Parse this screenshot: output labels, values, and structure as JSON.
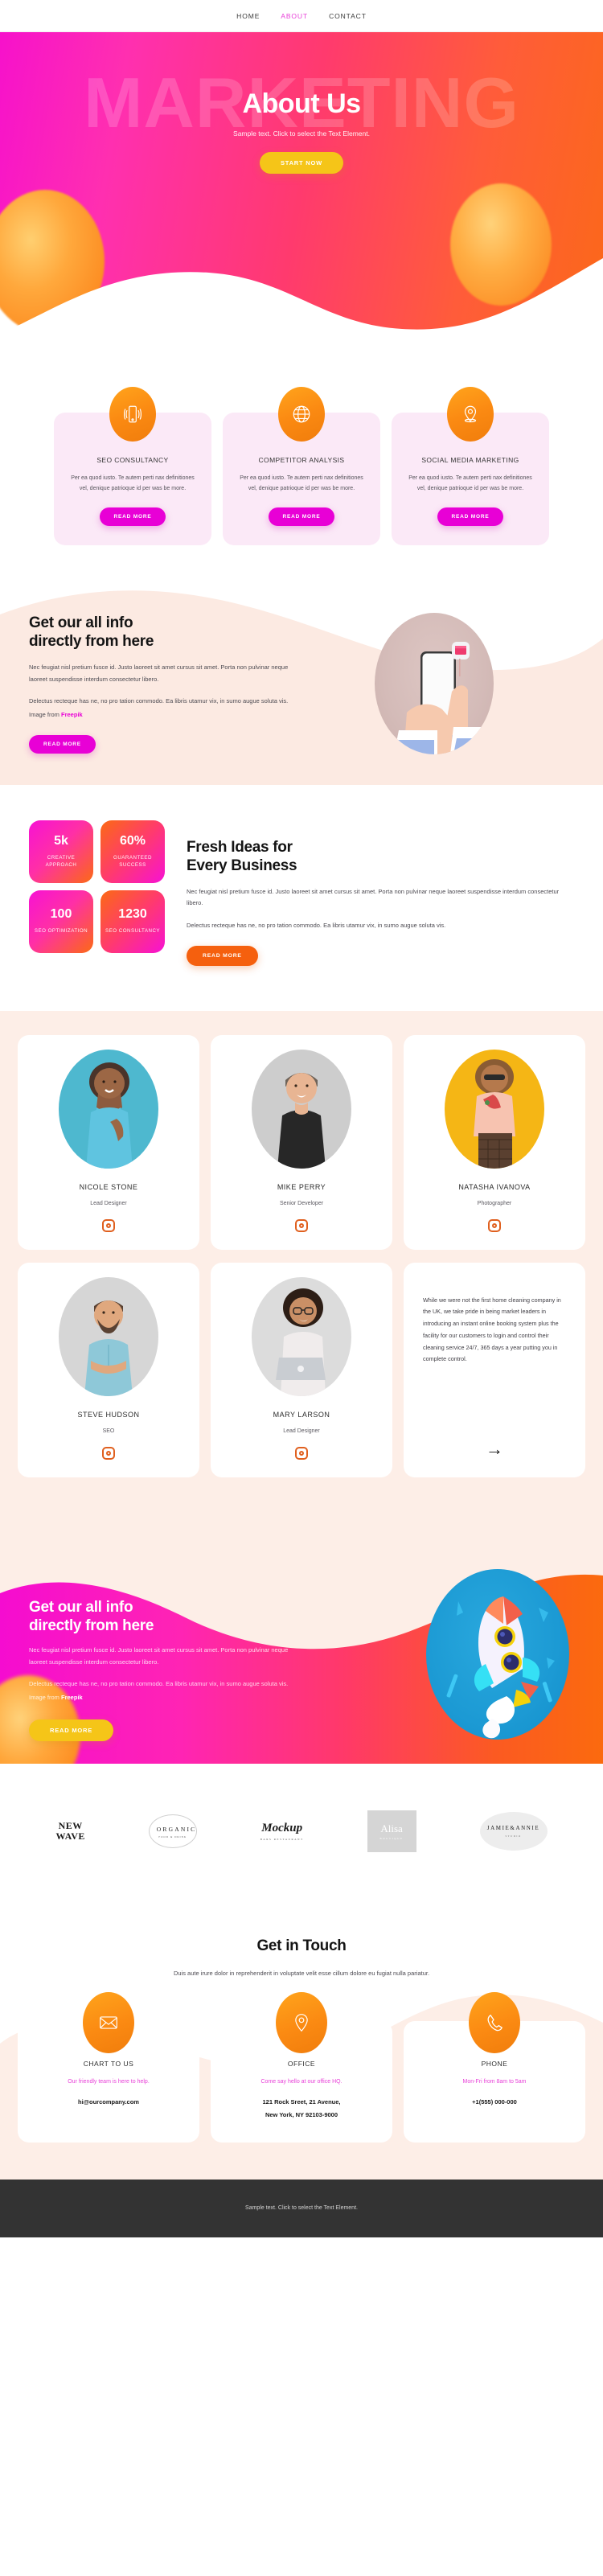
{
  "nav": {
    "items": [
      {
        "label": "HOME",
        "active": false
      },
      {
        "label": "ABOUT",
        "active": true
      },
      {
        "label": "CONTACT",
        "active": false
      }
    ]
  },
  "hero": {
    "ghost_word": "MARKETING",
    "title": "About Us",
    "subtitle": "Sample text. Click to select the Text Element.",
    "cta_label": "START NOW"
  },
  "services": {
    "items": [
      {
        "icon": "mobile-signal-icon",
        "title": "SEO CONSULTANCY",
        "text": "Per ea quod iusto. Te autem perti nax definitiones vel, denique patrioque id per was be more.",
        "button": "READ MORE"
      },
      {
        "icon": "globe-icon",
        "title": "COMPETITOR ANALYSIS",
        "text": "Per ea quod iusto. Te autem perti nax definitiones vel, denique patrioque id per was be more.",
        "button": "READ MORE"
      },
      {
        "icon": "map-pin-icon",
        "title": "SOCIAL MEDIA MARKETING",
        "text": "Per ea quod iusto. Te autem perti nax definitiones vel, denique patrioque id per was be more.",
        "button": "READ MORE"
      }
    ]
  },
  "info": {
    "title_line1": "Get our all info",
    "title_line2": "directly from here",
    "paragraph1": "Nec feugiat nisl pretium fusce id. Justo laoreet sit amet cursus sit amet. Porta non pulvinar neque laoreet suspendisse interdum consectetur libero.",
    "paragraph2_pre": "Delectus recteque has ne, no pro tation commodo. Ea libris utamur vix, in sumo augue soluta vis. Image from ",
    "paragraph2_link": "Freepik",
    "button": "READ MORE",
    "image_alt": "hand-holding-phone-illustration"
  },
  "stats": {
    "boxes": [
      {
        "number": "5k",
        "label": "CREATIVE APPROACH"
      },
      {
        "number": "60%",
        "label": "GUARANTEED SUCCESS"
      },
      {
        "number": "100",
        "label": "SEO OPTIMIZATION"
      },
      {
        "number": "1230",
        "label": "SEO CONSULTANCY"
      }
    ],
    "title_line1": "Fresh Ideas for",
    "title_line2": "Every Business",
    "paragraph1": "Nec feugiat nisl pretium fusce id. Justo laoreet sit amet cursus sit amet. Porta non pulvinar neque laoreet suspendisse interdum consectetur libero.",
    "paragraph2": "Delectus recteque has ne, no pro tation commodo. Ea libris utamur vix, in sumo augue soluta vis.",
    "button": "READ MORE"
  },
  "team": {
    "members": [
      {
        "name": "NICOLE STONE",
        "role": "Lead Designer",
        "social": "instagram-icon"
      },
      {
        "name": "MIKE PERRY",
        "role": "Senior Developer",
        "social": "instagram-icon"
      },
      {
        "name": "NATASHA IVANOVA",
        "role": "Photographer",
        "social": "instagram-icon"
      },
      {
        "name": "STEVE HUDSON",
        "role": "SEO",
        "social": "instagram-icon"
      },
      {
        "name": "MARY LARSON",
        "role": "Lead Designer",
        "social": "instagram-icon"
      }
    ],
    "quote": "While we were not the first home cleaning company in the UK, we take pride in being market leaders in introducing an instant online booking system plus the facility for our customers to login and control their cleaning service 24/7, 365 days a year putting you in complete control.",
    "quote_arrow": "→"
  },
  "cta": {
    "title_line1": "Get our all info",
    "title_line2": "directly from here",
    "paragraph1": "Nec feugiat nisl pretium fusce id. Justo laoreet sit amet cursus sit amet. Porta non pulvinar neque laoreet suspendisse interdum consectetur libero.",
    "paragraph2_pre": "Delectus recteque has ne, no pro tation commodo. Ea libris utamur vix, in sumo augue soluta vis. Image from ",
    "paragraph2_link": "Freepik",
    "button": "READ MORE",
    "image_alt": "rocket-illustration"
  },
  "logos": {
    "items": [
      {
        "name": "NEW WAVE",
        "line1": "NEW",
        "line2": "WAVE",
        "sub": ""
      },
      {
        "name": "ORGANIC",
        "line1": "ORGANIC",
        "line2": "",
        "sub": "FOOD & DRINK"
      },
      {
        "name": "Mockup",
        "line1": "Mockup",
        "line2": "",
        "sub": "BARS RESTAURANT"
      },
      {
        "name": "Alisa",
        "line1": "Alisa",
        "line2": "",
        "sub": "BOUTIQUE"
      },
      {
        "name": "JAMIE&ANNIE",
        "line1": "JAMIE&ANNIE",
        "line2": "",
        "sub": "STUDIO"
      }
    ]
  },
  "contact": {
    "title": "Get in Touch",
    "subtitle": "Duis aute irure dolor in reprehenderit in voluptate velit esse cillum dolore eu fugiat nulla pariatur.",
    "cards": [
      {
        "icon": "envelope-icon",
        "title": "CHART TO US",
        "note": "Our friendly team is here to help.",
        "value": "hi@ourcompany.com",
        "value2": ""
      },
      {
        "icon": "map-pin-icon",
        "title": "OFFICE",
        "note": "Come say hello at our office HQ.",
        "value": "121 Rock Sreet, 21 Avenue,",
        "value2": "New York, NY 92103-9000"
      },
      {
        "icon": "phone-icon",
        "title": "PHONE",
        "note": "Mon-Fri from 8am to 5am",
        "value": "+1(555) 000-000",
        "value2": ""
      }
    ]
  },
  "footer": {
    "text": "Sample text. Click to select the Text Element."
  },
  "colors": {
    "magenta": "#e800d6",
    "pink_accent": "#e83fd8",
    "orange": "#f5600e",
    "yellow": "#f5c518",
    "hero_gradient_start": "#f50cd0",
    "hero_gradient_end": "#fb6a14",
    "cream": "#fdeee7",
    "footer_bg": "#333333"
  }
}
